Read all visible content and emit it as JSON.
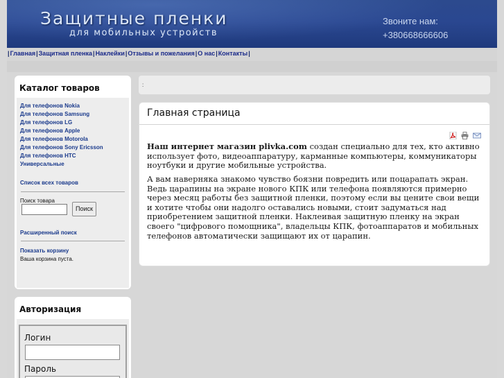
{
  "header": {
    "logo_title": "Защитные пленки",
    "logo_subtitle": "для мобильных устройств",
    "phone_label": "Звоните нам:",
    "phone_number": "+380668666606"
  },
  "nav": {
    "items": [
      {
        "label": "Главная"
      },
      {
        "label": "Защитная пленка"
      },
      {
        "label": "Наклейки"
      },
      {
        "label": "Отзывы и пожелания"
      },
      {
        "label": "О нас"
      },
      {
        "label": "Контакты"
      }
    ]
  },
  "catalog": {
    "title": "Каталог товаров",
    "items": [
      {
        "label": "Для телефонов Nokia"
      },
      {
        "label": "Для телефонов Samsung"
      },
      {
        "label": "Для телефонов LG"
      },
      {
        "label": "Для телефонов Apple"
      },
      {
        "label": "Для телефонов Motorola"
      },
      {
        "label": "Для телефонов Sony Ericsson"
      },
      {
        "label": "Для телефонов HTC"
      },
      {
        "label": "Универсальные"
      }
    ],
    "all_items_link": "Список всех товаров",
    "search_label": "Поиск товара",
    "search_value": "",
    "search_button": "Поиск",
    "advanced_search": "Расширенный поиск",
    "show_cart": "Показать корзину",
    "cart_empty": "Ваша корзина пуста."
  },
  "auth": {
    "title": "Авторизация",
    "login_label": "Логин",
    "login_value": "",
    "password_label": "Пароль"
  },
  "breadcrumb": {
    "text": ":"
  },
  "content": {
    "title": "Главная страница",
    "icons": [
      "pdf-icon",
      "print-icon",
      "email-icon"
    ],
    "para1_bold": "Наш интернет магазин plivka.com",
    "para1_rest": " создан специально для тех, кто активно использует фото, видеоаппаратуру, карманные компьютеры, коммуникаторы ноутбуки и другие мобильные устройства.",
    "para2": "А вам наверняка знакомо чувство боязни повредить или поцарапать экран. Ведь царапины на экране нового КПК или телефона появляются примерно через месяц работы без защитной пленки, поэтому если вы цените свои вещи и хотите чтобы они надолго оставались новыми, стоит задуматься над приобретением защитной пленки. Наклеивая защитную пленку на экран своего \"цифрового помощника\", владельцы КПК, фотоаппаратов и мобильных телефонов автоматически защищают их от царапин."
  }
}
